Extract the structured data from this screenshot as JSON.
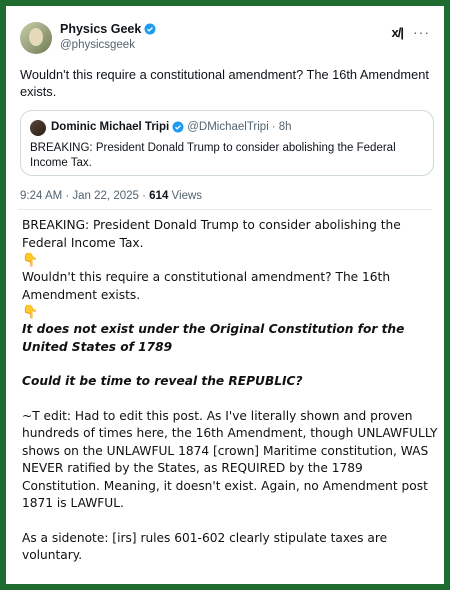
{
  "post": {
    "author_name": "Physics Geek",
    "author_handle": "@physicsgeek",
    "text": "Wouldn't this require a constitutional amendment? The 16th Amendment exists.",
    "quoted": {
      "author_name": "Dominic Michael Tripi",
      "author_handle": "@DMichaelTripi",
      "age": "· 8h",
      "text": "BREAKING: President Donald Trump to consider abolishing the Federal Income Tax."
    },
    "time": "9:24 AM · Jan 22, 2025 ·",
    "views_count": "614",
    "views_label": "Views"
  },
  "header_icons": {
    "grok": "x/|",
    "more": "···"
  },
  "commentary": {
    "line1": "BREAKING: President Donald Trump to consider abolishing the Federal Income Tax.",
    "emoji1": "👇",
    "line2": "Wouldn't this require a constitutional amendment? The 16th Amendment exists.",
    "emoji2": "👇",
    "line3": "It does not exist under the Original Constitution for the United States of 1789",
    "line4": "Could it be time to reveal the REPUBLIC?",
    "line5": "~T edit: Had to edit this post. As I've literally shown and proven hundreds of times here, the 16th Amendment, though UNLAWFULLY shows on the UNLAWFUL 1874 [crown] Maritime constitution, WAS NEVER ratified by the States, as REQUIRED by the 1789 Constitution. Meaning, it doesn't exist. Again, no Amendment post 1871 is LAWFUL.",
    "line6": "As a sidenote: [irs] rules 601-602 clearly stipulate taxes are voluntary."
  },
  "colors": {
    "frame": "#1f6b30",
    "verified": "#1d9bf0",
    "muted": "#536471"
  }
}
